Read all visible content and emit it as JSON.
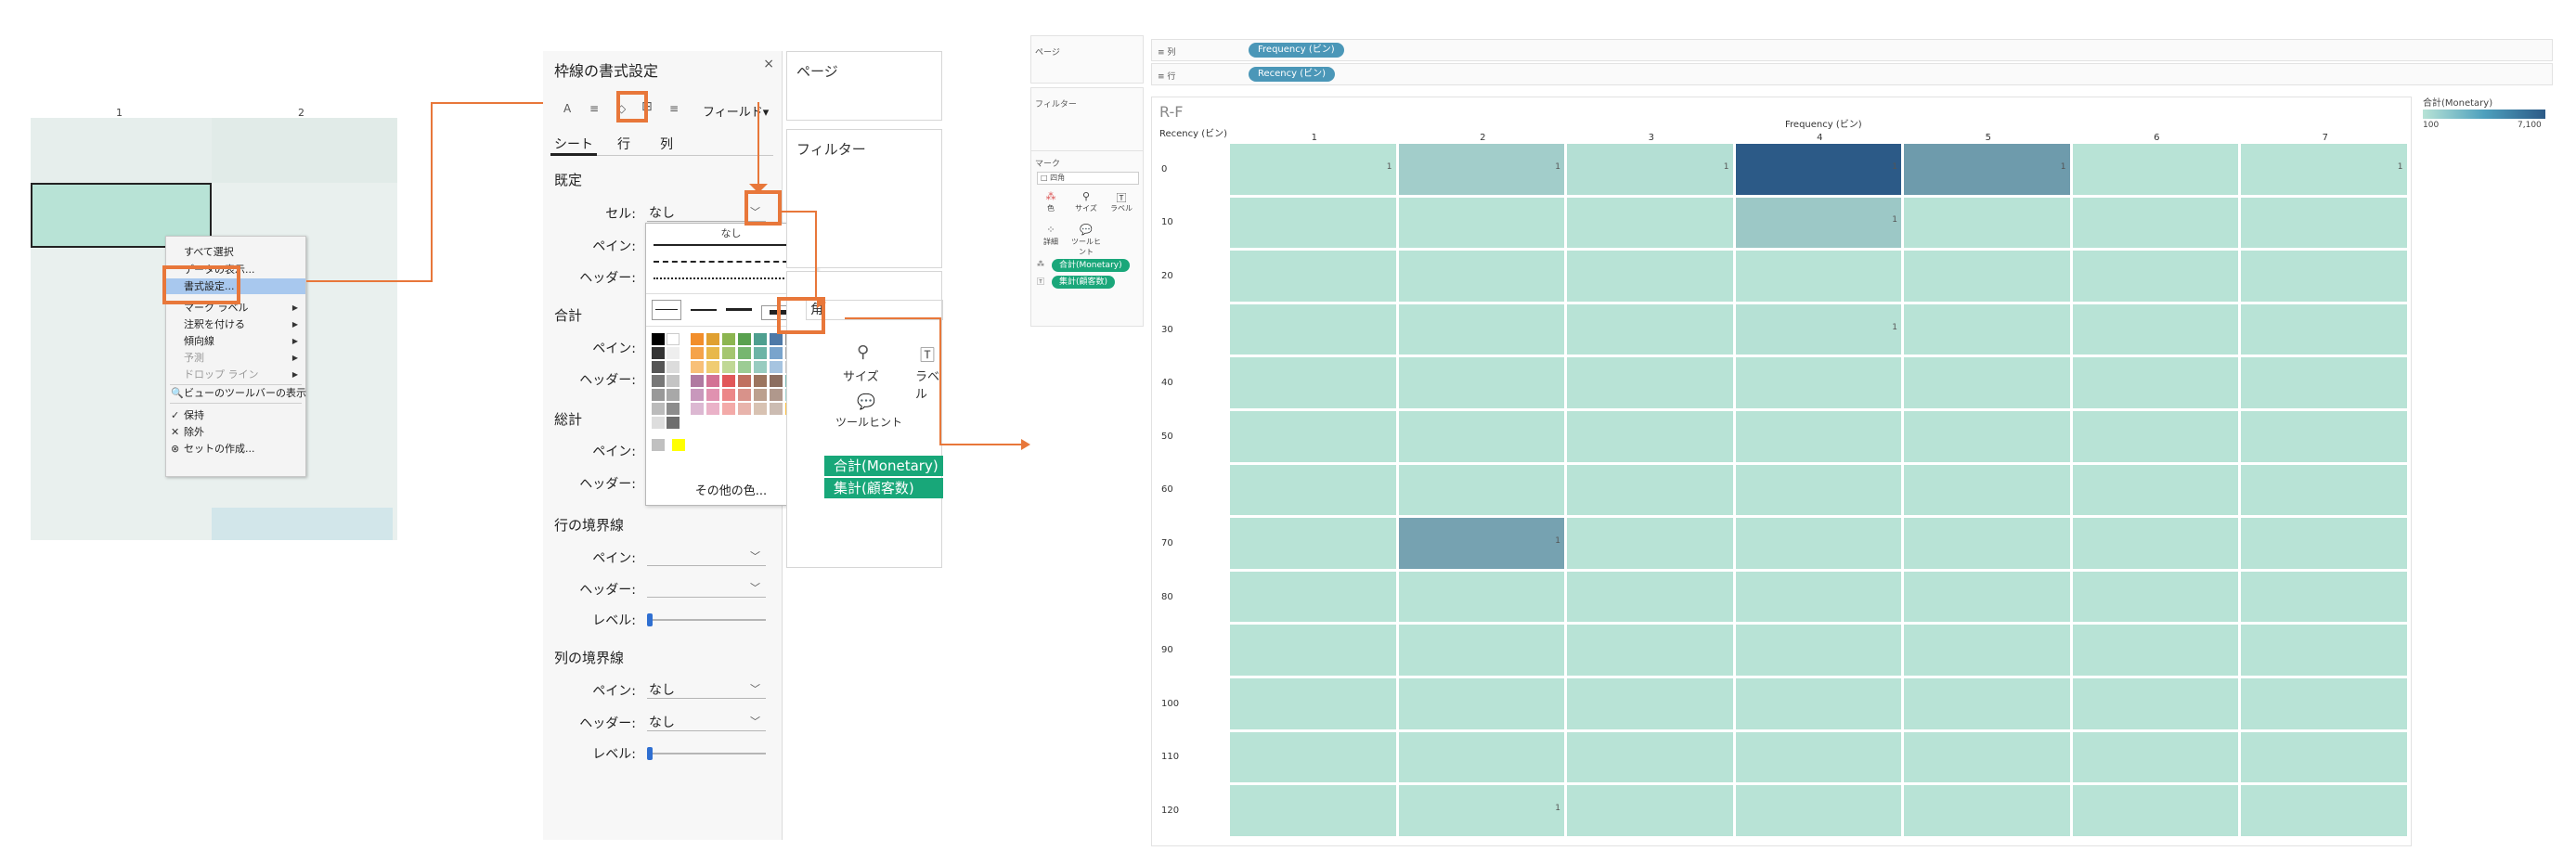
{
  "panel1": {
    "col_headers": [
      "1",
      "2"
    ],
    "menu": [
      {
        "label": "すべて選択",
        "state": "normal"
      },
      {
        "label": "データの表示...",
        "state": "normal"
      },
      {
        "label": "書式設定...",
        "state": "highlighted"
      },
      {
        "label": "マーク ラベル",
        "state": "submenu"
      },
      {
        "label": "注釈を付ける",
        "state": "submenu"
      },
      {
        "label": "傾向線",
        "state": "submenu"
      },
      {
        "label": "予測",
        "state": "disabled-submenu"
      },
      {
        "label": "ドロップ ライン",
        "state": "disabled-submenu"
      },
      {
        "label": "ビューのツールバーの表示",
        "state": "icon",
        "icon": "magnifier-icon"
      },
      {
        "label": "保持",
        "state": "icon",
        "icon": "check-icon"
      },
      {
        "label": "除外",
        "state": "icon",
        "icon": "x-icon"
      },
      {
        "label": "セットの作成...",
        "state": "icon",
        "icon": "set-icon"
      }
    ]
  },
  "panel2": {
    "title": "枠線の書式設定",
    "close": "×",
    "toolbar": {
      "font_icon": "A",
      "align_icon": "≡",
      "shading_icon": "◇",
      "borders_icon": "⊞",
      "lines_icon": "≡",
      "fields_label": "フィールド▾"
    },
    "tabs": [
      "シート",
      "行",
      "列"
    ],
    "sections": {
      "default": {
        "title": "既定",
        "cell_label": "セル:",
        "cell_value": "なし",
        "pane_label": "ペイン:",
        "header_label": "ヘッダー:"
      },
      "total": {
        "title": "合計",
        "pane_label": "ペイン:",
        "header_label": "ヘッダー:"
      },
      "grand_total": {
        "title": "総計",
        "pane_label": "ペイン:",
        "header_label": "ヘッダー:"
      },
      "row_divider": {
        "title": "行の境界線",
        "pane_label": "ペイン:",
        "header_label": "ヘッダー:",
        "level_label": "レベル:"
      },
      "col_divider": {
        "title": "列の境界線",
        "pane_label": "ペイン:",
        "pane_value": "なし",
        "header_label": "ヘッダー:",
        "header_value": "なし",
        "level_label": "レベル:"
      }
    },
    "popup": {
      "none_label": "なし",
      "more_colors": "その他の色..."
    },
    "palette": {
      "gray_col": [
        "#000000",
        "#333333",
        "#555555",
        "#777777",
        "#999999",
        "#bbbbbb",
        "#dddddd"
      ],
      "white_col": [
        "#ffffff",
        "#eeeeee",
        "#dcdcdc",
        "#c4c4c4",
        "#a8a8a8",
        "#8c8c8c",
        "#6e6e6e"
      ],
      "colors": [
        [
          "#f28e2b",
          "#e0a030",
          "#8cb550",
          "#59a14f",
          "#4e9f8f",
          "#4e79a7",
          "#8a8a8a"
        ],
        [
          "#f5a34a",
          "#e8b84a",
          "#a5c670",
          "#76b66f",
          "#6cb4a6",
          "#79a4cc",
          "#a6a6a6"
        ],
        [
          "#f8c078",
          "#f0cc72",
          "#c0d896",
          "#9ccc94",
          "#98ccc0",
          "#a6c4e0",
          "#c6c6c6"
        ],
        [
          "#b07aa1",
          "#d37295",
          "#e15759",
          "#c07060",
          "#9c755f",
          "#8c6e60",
          "#76b7b2"
        ],
        [
          "#c898bc",
          "#e092b0",
          "#ec8788",
          "#d8928a",
          "#bca08e",
          "#b0988c",
          "#9fd0cc"
        ],
        [
          "#dcb8d2",
          "#eab2c8",
          "#f3aaa8",
          "#e8b4ac",
          "#d8c2b2",
          "#ccbcb2",
          "#ffbe3c"
        ]
      ],
      "extra": [
        "#c0c0c0",
        "#ffff00"
      ]
    },
    "right_panels": {
      "pages": "ページ",
      "filters": "フィルター",
      "marks_shape": "角",
      "size_label": "サイズ",
      "label_label": "ラベル",
      "tooltip_label": "ツールヒント",
      "pill_monetary": "合計(Monetary)",
      "pill_count": "集計(顧客数)"
    }
  },
  "panel3": {
    "side": {
      "pages": "ページ",
      "filters": "フィルター",
      "marks": "マーク",
      "mark_type": "□ 四角",
      "mark_buttons": [
        "色",
        "サイズ",
        "ラベル",
        "詳細",
        "ツールヒント"
      ],
      "pills": [
        "合計(Monetary)",
        "集計(顧客数)"
      ]
    },
    "shelves": {
      "columns_label": "≡ 列",
      "columns_pill": "Frequency (ビン)",
      "rows_label": "≡ 行",
      "rows_pill": "Recency (ビン)"
    },
    "legend": {
      "title": "合計(Monetary)",
      "min": "100",
      "max": "7,100"
    }
  },
  "chart_data": {
    "type": "heatmap",
    "title": "R-F",
    "xlabel": "Frequency (ビン)",
    "ylabel": "Recency (ビン)",
    "x": [
      "1",
      "2",
      "3",
      "4",
      "5",
      "6",
      "7"
    ],
    "y": [
      "0",
      "10",
      "20",
      "30",
      "40",
      "50",
      "60",
      "70",
      "80",
      "90",
      "100",
      "110",
      "120"
    ],
    "color_range": [
      100,
      7100
    ],
    "color_scale": [
      "#b8e3d6",
      "#2c5a87"
    ],
    "cells": [
      {
        "x": "1",
        "y": "0",
        "monetary": 100,
        "label": "1"
      },
      {
        "x": "2",
        "y": "0",
        "monetary": 1200,
        "label": "1"
      },
      {
        "x": "3",
        "y": "0",
        "monetary": 300,
        "label": "1"
      },
      {
        "x": "4",
        "y": "0",
        "monetary": 7100,
        "label": "1"
      },
      {
        "x": "5",
        "y": "0",
        "monetary": 3800,
        "label": "1"
      },
      {
        "x": "7",
        "y": "0",
        "monetary": 100,
        "label": "1"
      },
      {
        "x": "4",
        "y": "10",
        "monetary": 1500,
        "label": "1"
      },
      {
        "x": "4",
        "y": "30",
        "monetary": 200,
        "label": "1"
      },
      {
        "x": "2",
        "y": "70",
        "monetary": 3400,
        "label": "1"
      },
      {
        "x": "2",
        "y": "120",
        "monetary": 100,
        "label": "1"
      }
    ],
    "default_color": "#b8e3d6"
  }
}
